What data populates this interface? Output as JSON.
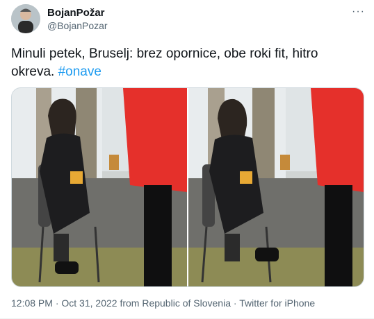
{
  "author": {
    "name": "BojanPožar",
    "handle": "@BojanPozar"
  },
  "tweet": {
    "text": "Minuli petek, Bruselj: brez opornice, obe roki fit, hitro okreva. ",
    "hashtag": "#onave"
  },
  "meta": {
    "time": "12:08 PM",
    "date": "Oct 31, 2022",
    "location": "from Republic of Slovenia",
    "source": "Twitter for iPhone",
    "sep": " · "
  },
  "icons": {
    "more": "more-icon"
  },
  "colors": {
    "link": "#1d9bf0",
    "muted": "#536471"
  }
}
